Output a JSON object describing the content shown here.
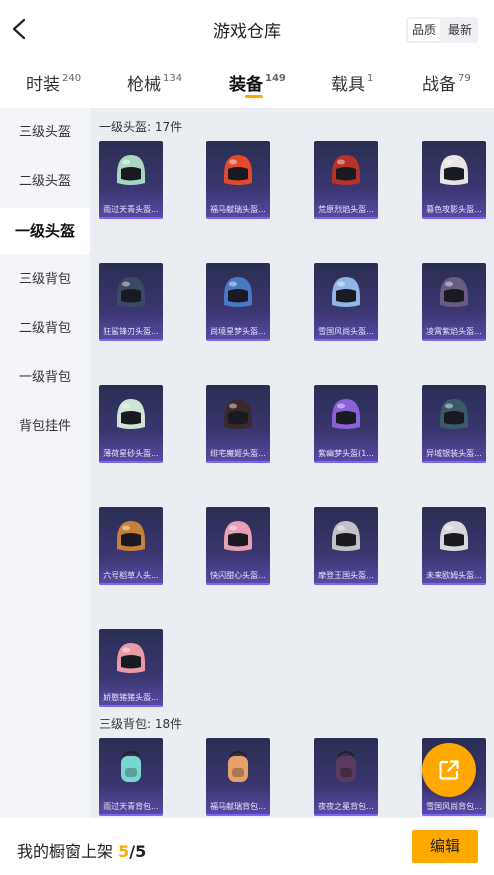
{
  "header": {
    "title": "游戏仓库",
    "toggle": [
      "品质",
      "最新"
    ]
  },
  "tabs": [
    {
      "label": "时装",
      "count": "240"
    },
    {
      "label": "枪械",
      "count": "134"
    },
    {
      "label": "装备",
      "count": "149"
    },
    {
      "label": "载具",
      "count": "1"
    },
    {
      "label": "战备",
      "count": "79"
    }
  ],
  "sidebar": [
    "三级头盔",
    "二级头盔",
    "一级头盔",
    "三级背包",
    "二级背包",
    "一级背包",
    "背包挂件"
  ],
  "sections": [
    {
      "title": "一级头盔: 17件",
      "items": [
        {
          "name": "雨过天青头盔...",
          "color": "#a9d6c2"
        },
        {
          "name": "福马献瑞头盔...",
          "color": "#e24a2c"
        },
        {
          "name": "荒原烈焰头盔...",
          "color": "#b8322a"
        },
        {
          "name": "暮色攻影头盔...",
          "color": "#e8e4e4"
        },
        {
          "name": "狂鲨锋刃头盔...",
          "color": "#3a4a66"
        },
        {
          "name": "尚境星梦头盔...",
          "color": "#4a78c2"
        },
        {
          "name": "雪国风尚头盔...",
          "color": "#8fb6e6"
        },
        {
          "name": "凌霄紫焰头盔...",
          "color": "#6a5a86"
        },
        {
          "name": "薄荷星砂头盔...",
          "color": "#cfe6d6"
        },
        {
          "name": "绯宅魔姬头盔...",
          "color": "#3a2a2e"
        },
        {
          "name": "紫幽梦头盔(1...",
          "color": "#8a62d6"
        },
        {
          "name": "异域银装头盔...",
          "color": "#3a5a6a"
        },
        {
          "name": "六号稻草人头...",
          "color": "#c6803a"
        },
        {
          "name": "快闪甜心头盔...",
          "color": "#e8a0b8"
        },
        {
          "name": "摩登王国头盔...",
          "color": "#c2c2c6"
        },
        {
          "name": "未来欧姆头盔...",
          "color": "#d8d8dc"
        },
        {
          "name": "娇憨猪猪头盔...",
          "color": "#e89aa6"
        }
      ]
    },
    {
      "title": "三级背包: 18件",
      "items": [
        {
          "name": "雨过天青背包...",
          "color": "#7ad6d0"
        },
        {
          "name": "福马献瑞背包...",
          "color": "#e8a06a"
        },
        {
          "name": "夜夜之冕背包...",
          "color": "#5a3a5e"
        },
        {
          "name": "雪国风尚背包...",
          "color": "#a6c6e6"
        }
      ]
    }
  ],
  "footer": {
    "label": "我的橱窗上架",
    "current": "5",
    "total": "/5",
    "edit": "编辑"
  }
}
